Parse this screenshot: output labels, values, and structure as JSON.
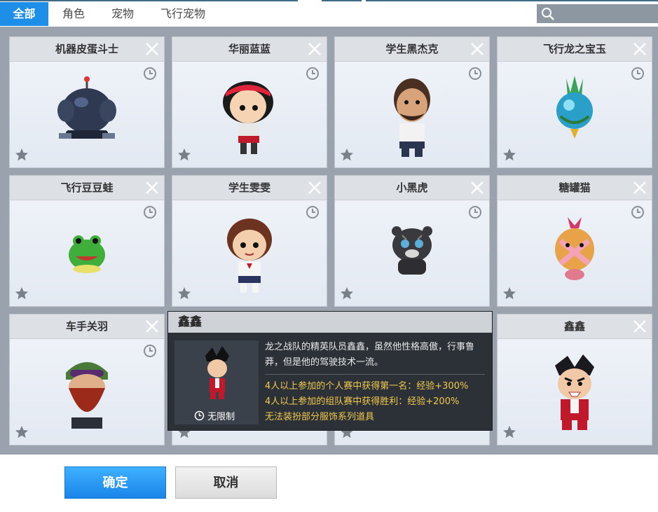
{
  "tabs": [
    {
      "label": "全部",
      "active": true
    },
    {
      "label": "角色",
      "active": false
    },
    {
      "label": "宠物",
      "active": false
    },
    {
      "label": "飞行宠物",
      "active": false
    }
  ],
  "search": {
    "placeholder": ""
  },
  "items": [
    {
      "name": "机器皮蛋斗士",
      "icon": "robot-bomb-figure"
    },
    {
      "name": "华丽蓝蓝",
      "icon": "girl-red-headband-figure"
    },
    {
      "name": "学生黑杰克",
      "icon": "mustache-man-figure"
    },
    {
      "name": "飞行龙之宝玉",
      "icon": "dragon-jewel-figure"
    },
    {
      "name": "飞行豆豆蛙",
      "icon": "green-frog-figure"
    },
    {
      "name": "学生雯雯",
      "icon": "schoolgirl-figure"
    },
    {
      "name": "小黑虎",
      "icon": "black-tiger-figure"
    },
    {
      "name": "糖罐猫",
      "icon": "candy-cat-figure"
    },
    {
      "name": "车手关羽",
      "icon": "bearded-racer-figure"
    },
    {
      "name": "",
      "icon": "hidden"
    },
    {
      "name": "",
      "icon": "hidden"
    },
    {
      "name": "鑫鑫",
      "icon": "xinxin-figure"
    }
  ],
  "tooltip": {
    "title": "鑫鑫",
    "limit_label": "无限制",
    "description": "龙之战队的精英队员鑫鑫，虽然他性格高傲，行事鲁莽，但是他的驾驶技术一流。",
    "bonuses": [
      "4人以上参加的个人赛中获得第一名：经验+300%",
      "4人以上参加的组队赛中获得胜利：经验+200%",
      "无法装扮部分服饰系列道具"
    ]
  },
  "buttons": {
    "confirm": "确定",
    "cancel": "取消"
  },
  "colors": {
    "accent": "#1e8fe8",
    "bonus_text": "#f2c94c",
    "panel": "#9aa3ad"
  }
}
